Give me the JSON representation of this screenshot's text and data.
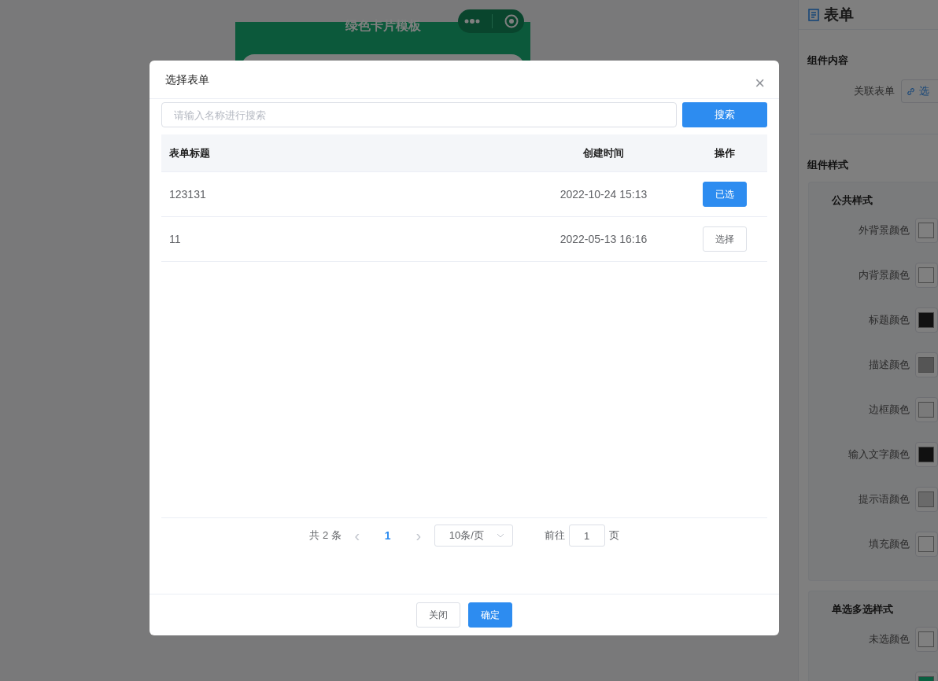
{
  "preview": {
    "title": "绿色卡片模板"
  },
  "panel": {
    "title": "表单",
    "section_content": "组件内容",
    "link_label": "关联表单",
    "link_button": "选",
    "section_style": "组件样式",
    "groups": [
      {
        "title": "公共样式",
        "items": [
          {
            "label": "外背景颜色",
            "color": "#808080"
          },
          {
            "label": "内背景颜色",
            "color": "#808080"
          },
          {
            "label": "标题颜色",
            "color": "#111111"
          },
          {
            "label": "描述颜色",
            "color": "#555555"
          },
          {
            "label": "边框颜色",
            "color": "#7a7a7a"
          },
          {
            "label": "输入文字颜色",
            "color": "#111111"
          },
          {
            "label": "提示语颜色",
            "color": "#6a6a6a"
          },
          {
            "label": "填充颜色",
            "color": "#808080"
          }
        ]
      },
      {
        "title": "单选多选样式",
        "items": [
          {
            "label": "未选颜色",
            "color": "#808080"
          },
          {
            "color": "#0b5f40"
          }
        ]
      }
    ]
  },
  "dialog": {
    "title": "选择表单",
    "close": "×",
    "search": {
      "placeholder": "请输入名称进行搜索",
      "button": "搜索"
    },
    "table": {
      "columns": [
        "表单标题",
        "创建时间",
        "操作"
      ],
      "rows": [
        {
          "title": "123131",
          "created": "2022-10-24 15:13",
          "action": "已选",
          "selected": true
        },
        {
          "title": "11",
          "created": "2022-05-13 16:16",
          "action": "选择",
          "selected": false
        }
      ]
    },
    "pagination": {
      "total": "共 2 条",
      "prev": "‹",
      "pages": [
        {
          "label": "1",
          "selected": true
        }
      ],
      "next": "›",
      "page_size": "10条/页",
      "goto": "前往",
      "goto_value": "1",
      "page_unit": "页"
    },
    "buttons": [
      {
        "label": "关闭",
        "kind": "plain"
      },
      {
        "label": "确定",
        "kind": "primary"
      }
    ]
  }
}
